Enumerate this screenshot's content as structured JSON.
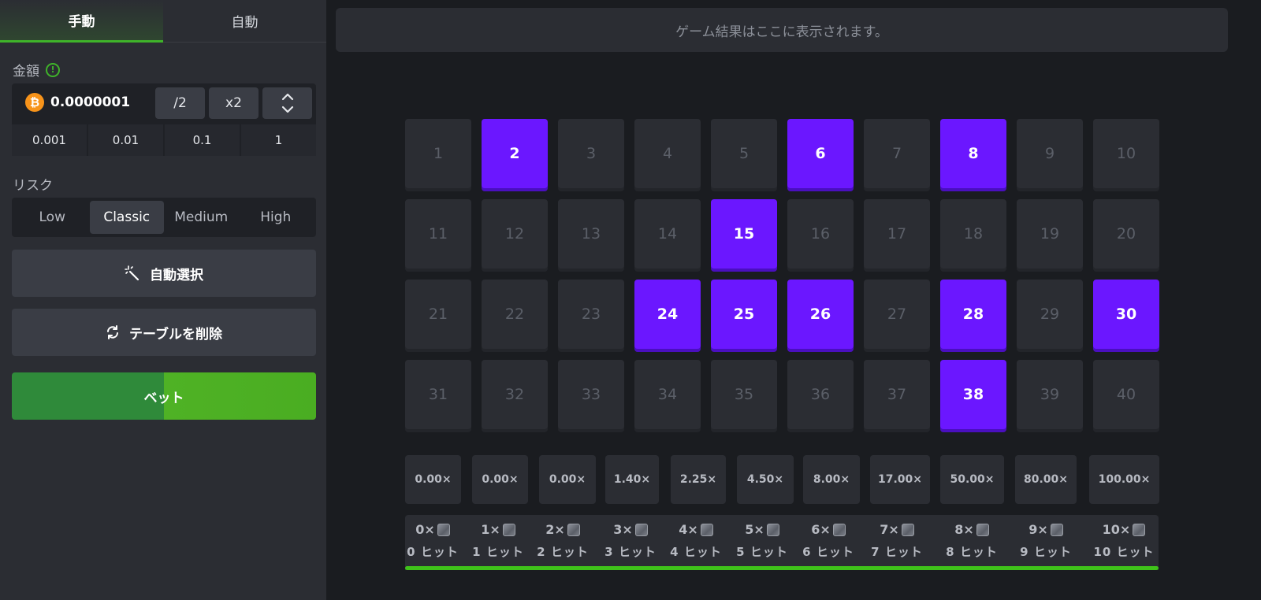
{
  "tabs": {
    "manual": "手動",
    "auto": "自動"
  },
  "amount": {
    "label": "金額",
    "info_icon": "!",
    "currency_symbol": "₿",
    "value": "0.0000001",
    "half": "/2",
    "double": "x2",
    "presets": [
      "0.001",
      "0.01",
      "0.1",
      "1"
    ]
  },
  "risk": {
    "label": "リスク",
    "options": [
      "Low",
      "Classic",
      "Medium",
      "High"
    ],
    "selected": "Classic"
  },
  "buttons": {
    "auto_select": "自動選択",
    "clear_table": "テーブルを削除",
    "bet": "ベット"
  },
  "result_placeholder": "ゲーム結果はここに表示されます。",
  "tiles": [
    "1",
    "2",
    "3",
    "4",
    "5",
    "6",
    "7",
    "8",
    "9",
    "10",
    "11",
    "12",
    "13",
    "14",
    "15",
    "16",
    "17",
    "18",
    "19",
    "20",
    "21",
    "22",
    "23",
    "24",
    "25",
    "26",
    "27",
    "28",
    "29",
    "30",
    "31",
    "32",
    "33",
    "34",
    "35",
    "36",
    "37",
    "38",
    "39",
    "40"
  ],
  "selected_tiles": [
    "2",
    "6",
    "8",
    "15",
    "24",
    "25",
    "26",
    "28",
    "30",
    "38"
  ],
  "payouts": [
    "0.00×",
    "0.00×",
    "0.00×",
    "1.40×",
    "2.25×",
    "4.50×",
    "8.00×",
    "17.00×",
    "50.00×",
    "80.00×",
    "100.00×"
  ],
  "hits": {
    "counts": [
      "0×",
      "1×",
      "2×",
      "3×",
      "4×",
      "5×",
      "6×",
      "7×",
      "8×",
      "9×",
      "10×"
    ],
    "labels": [
      "0 ヒット",
      "1 ヒット",
      "2 ヒット",
      "3 ヒット",
      "4 ヒット",
      "5 ヒット",
      "6 ヒット",
      "7 ヒット",
      "8 ヒット",
      "9 ヒット",
      "10 ヒット"
    ]
  },
  "colors": {
    "accent_green": "#3fb32a",
    "selected_tile": "#6b17ff",
    "bitcoin": "#f7931a"
  }
}
